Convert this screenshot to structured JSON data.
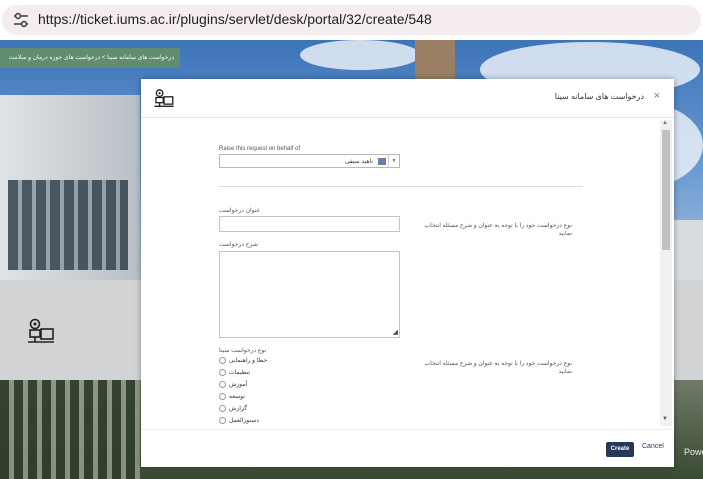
{
  "browser": {
    "url": "https://ticket.iums.ac.ir/plugins/servlet/desk/portal/32/create/548",
    "site_info_icon": "tune-icon"
  },
  "background_page": {
    "breadcrumb": "درخواست های سامانه سینا  >  درخواست های حوزه درمان و سلامت",
    "powered_by": "Powe"
  },
  "modal": {
    "title": "درخواست های سامانه سینا",
    "close_icon": "close-icon",
    "fields": {
      "behalf_label": "Raise this request on behalf of",
      "behalf_value": "ناهید سیفی",
      "summary_label": "عنوان درخواست",
      "summary_value": "",
      "summary_help": "نوع درخواست خود را با توجه به عنوان و شرح مسئله انتخاب نمایید",
      "description_label": "شرح درخواست",
      "description_value": "",
      "type_label": "نوع درخواست سینا",
      "type_help": "نوع درخواست خود را با توجه به عنوان و شرح مسئله انتخاب نمایید",
      "type_options": [
        "خطا و راهنمایی",
        "تنظیمات",
        "آموزش",
        "توسعه",
        "گزارش",
        "دستورالعمل"
      ]
    },
    "footer": {
      "create_label": "Create",
      "cancel_label": "Cancel"
    }
  },
  "colors": {
    "primary_button": "#253858",
    "breadcrumb_bar": "#5f8d6d",
    "address_bar": "#f5eded"
  }
}
